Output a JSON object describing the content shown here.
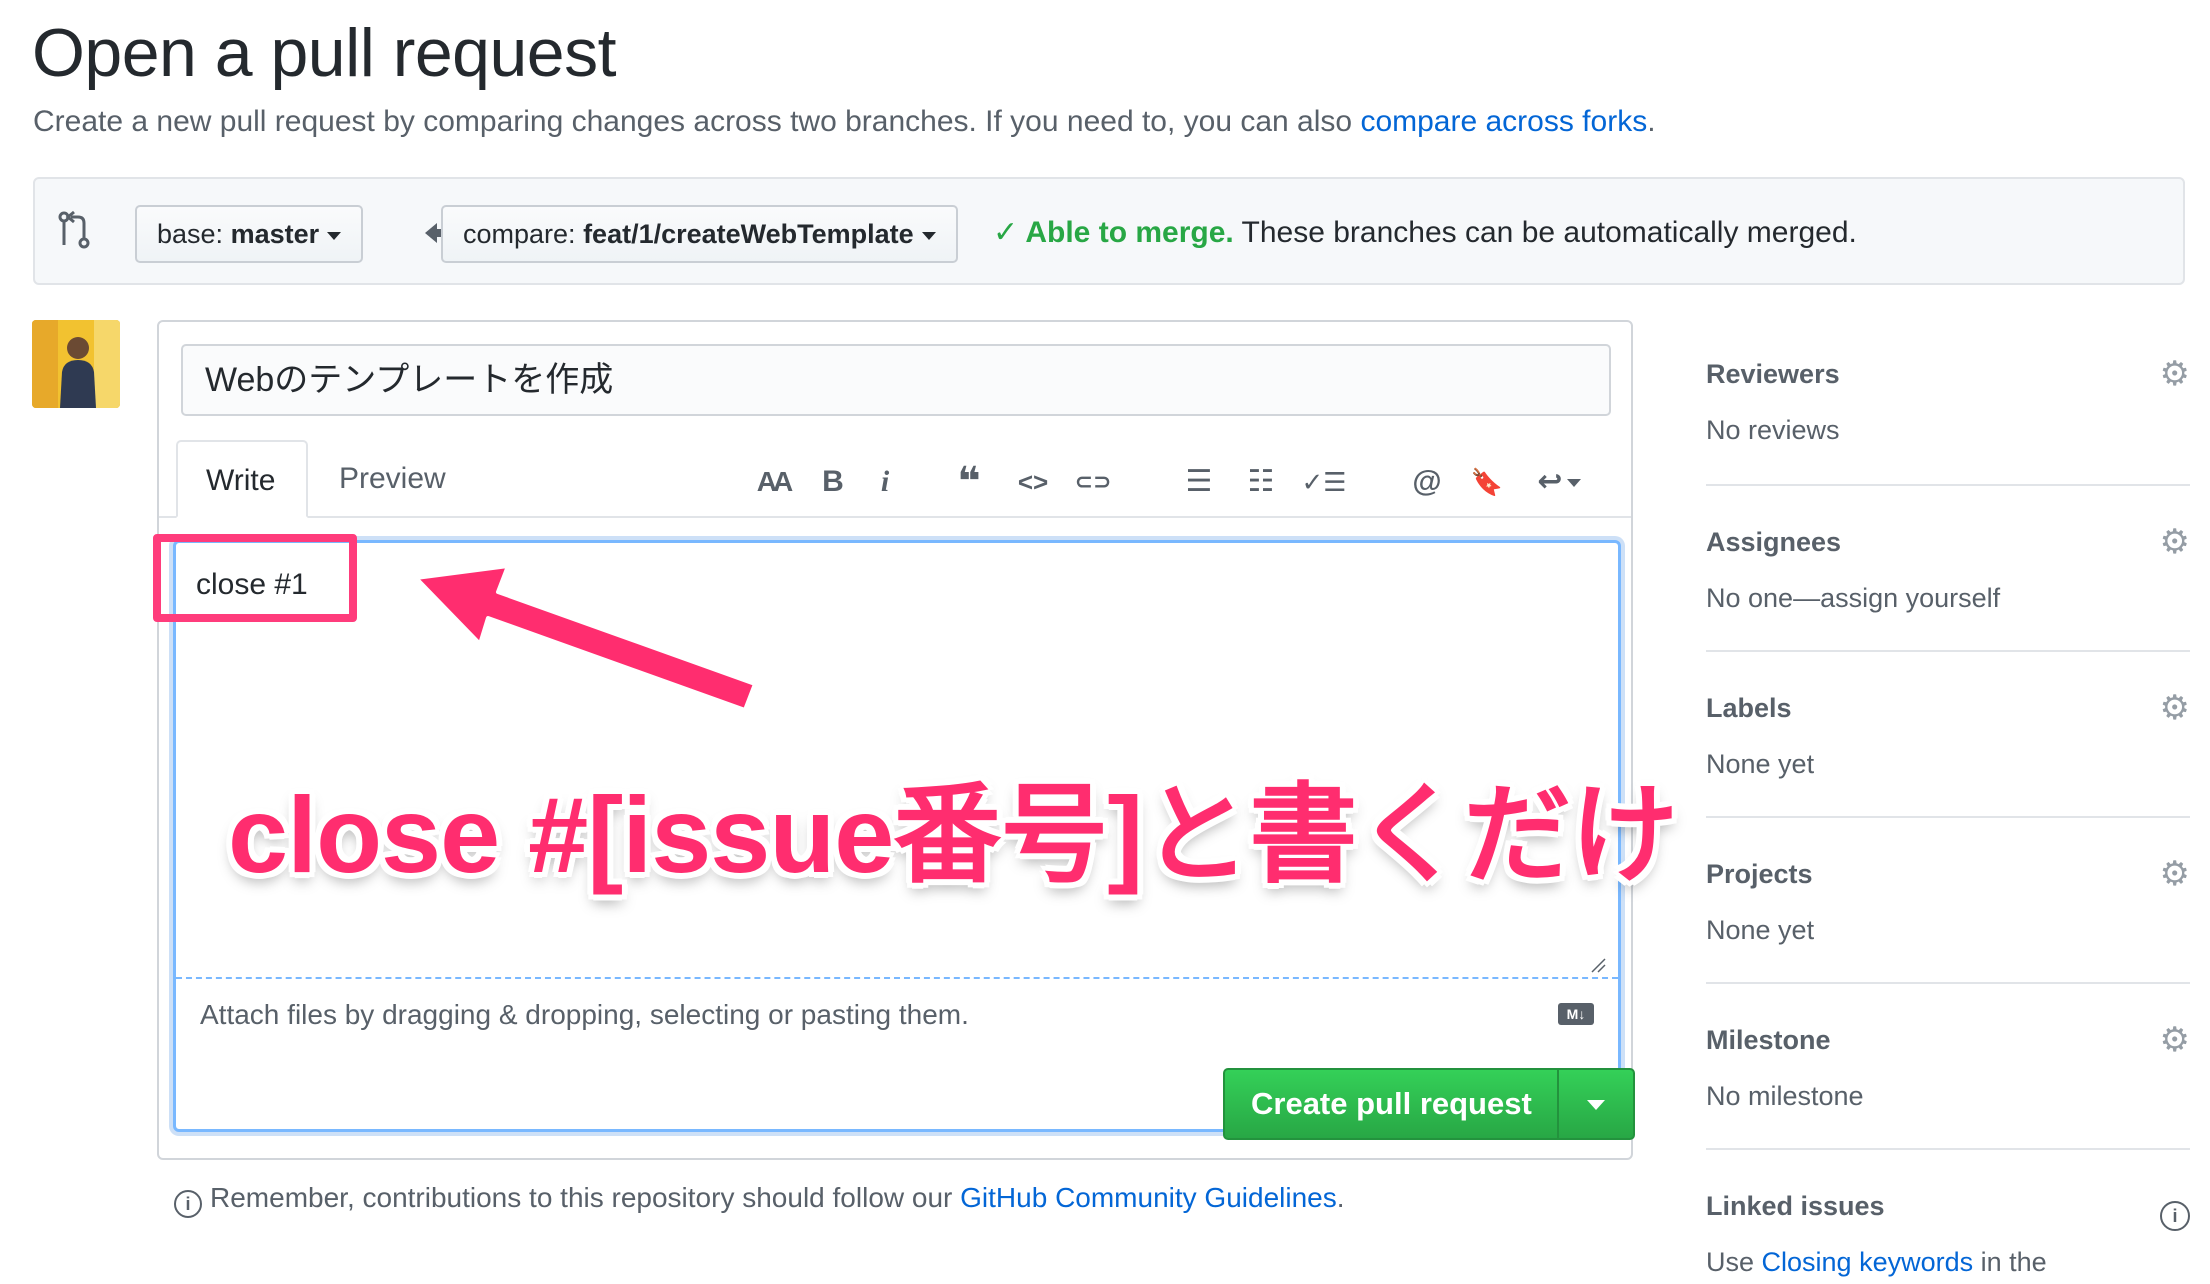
{
  "header": {
    "title": "Open a pull request",
    "subtitle_text": "Create a new pull request by comparing changes across two branches. If you need to, you can also ",
    "subtitle_link": "compare across forks",
    "subtitle_end": "."
  },
  "compare": {
    "base_prefix": "base: ",
    "base_branch": "master",
    "compare_prefix": "compare: ",
    "compare_branch": "feat/1/createWebTemplate",
    "merge_ok": "Able to merge.",
    "merge_detail": " These branches can be automatically merged."
  },
  "composer": {
    "title_value": "Webのテンプレートを作成",
    "tabs": {
      "write": "Write",
      "preview": "Preview"
    },
    "toolbar": {
      "heading": "AA",
      "bold": "B",
      "italic": "i",
      "quote": "❝",
      "code": "<>",
      "link": "⊂⊃",
      "unordered_list": "☰",
      "ordered_list": "☷",
      "task_list": "✓☰",
      "mention": "@",
      "reference": "🔖",
      "reply": "↩"
    },
    "body_value": "close #1",
    "attach_text": "Attach files by dragging & dropping, selecting or pasting them.",
    "markdown_badge": "M↓",
    "submit_label": "Create pull request"
  },
  "guidelines": {
    "text": "Remember, contributions to this repository should follow our ",
    "link": "GitHub Community Guidelines",
    "end": "."
  },
  "sidebar": {
    "reviewers": {
      "heading": "Reviewers",
      "value": "No reviews"
    },
    "assignees": {
      "heading": "Assignees",
      "value": "No one—assign yourself"
    },
    "labels": {
      "heading": "Labels",
      "value": "None yet"
    },
    "projects": {
      "heading": "Projects",
      "value": "None yet"
    },
    "milestone": {
      "heading": "Milestone",
      "value": "No milestone"
    },
    "linked_issues": {
      "heading": "Linked issues",
      "value_pre": "Use ",
      "value_link": "Closing keywords",
      "value_post": " in the"
    }
  },
  "annotation": {
    "text": "close #[issue番号]と書くだけ",
    "color": "#ff2d6f"
  },
  "colors": {
    "link": "#0366d6",
    "success": "#28a745",
    "focus": "#79b8ff"
  }
}
